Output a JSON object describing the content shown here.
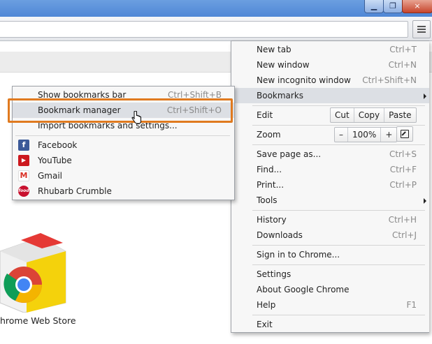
{
  "window": {
    "minimize_icon": "minimize-icon",
    "maximize_icon": "restore-icon",
    "close_icon": "close-icon",
    "close_glyph": "×"
  },
  "apps": {
    "store_label": "Chrome Web Store",
    "store_label_visible": "hrome Web Store"
  },
  "main_menu": {
    "new_tab": {
      "label": "New tab",
      "accel": "Ctrl+T"
    },
    "new_window": {
      "label": "New window",
      "accel": "Ctrl+N"
    },
    "new_incognito": {
      "label": "New incognito window",
      "accel": "Ctrl+Shift+N"
    },
    "bookmarks": {
      "label": "Bookmarks"
    },
    "edit": {
      "label": "Edit",
      "cut": "Cut",
      "copy": "Copy",
      "paste": "Paste"
    },
    "zoom": {
      "label": "Zoom",
      "minus": "–",
      "value": "100%",
      "plus": "+"
    },
    "save_page": {
      "label": "Save page as...",
      "accel": "Ctrl+S"
    },
    "find": {
      "label": "Find...",
      "accel": "Ctrl+F"
    },
    "print": {
      "label": "Print...",
      "accel": "Ctrl+P"
    },
    "tools": {
      "label": "Tools"
    },
    "history": {
      "label": "History",
      "accel": "Ctrl+H"
    },
    "downloads": {
      "label": "Downloads",
      "accel": "Ctrl+J"
    },
    "sign_in": {
      "label": "Sign in to Chrome..."
    },
    "settings": {
      "label": "Settings"
    },
    "about": {
      "label": "About Google Chrome"
    },
    "help": {
      "label": "Help",
      "accel": "F1"
    },
    "exit": {
      "label": "Exit"
    }
  },
  "bookmarks_menu": {
    "show_bar": {
      "label": "Show bookmarks bar",
      "accel": "Ctrl+Shift+B"
    },
    "manager": {
      "label": "Bookmark manager",
      "accel": "Ctrl+Shift+O"
    },
    "import": {
      "label": "Import bookmarks and settings..."
    },
    "items": [
      {
        "label": "Facebook",
        "icon": "facebook-icon",
        "color": "#3b5998",
        "glyph": "f"
      },
      {
        "label": "YouTube",
        "icon": "youtube-icon",
        "color": "#cc181e",
        "glyph": "▶"
      },
      {
        "label": "Gmail",
        "icon": "gmail-icon",
        "color": "#d93025",
        "glyph": "M"
      },
      {
        "label": "Rhubarb Crumble",
        "icon": "food-icon",
        "color": "#c8102e",
        "glyph": "food"
      }
    ]
  },
  "colors": {
    "highlight_box": "#e07a1f",
    "title_bar": "#4f87d6"
  }
}
